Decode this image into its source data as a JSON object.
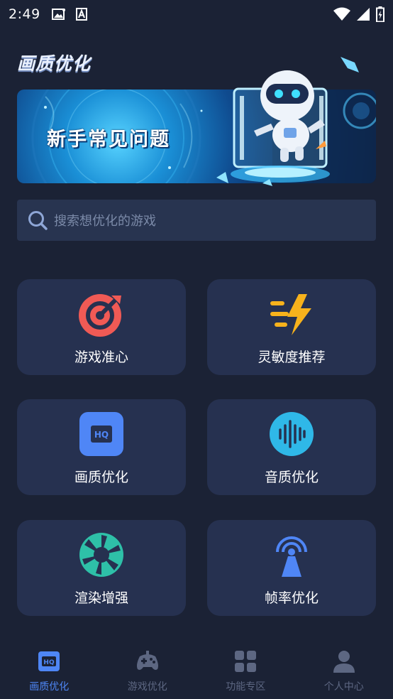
{
  "status_bar": {
    "time": "2:49",
    "left_icons": [
      "image-icon",
      "a-icon"
    ],
    "right_icons": [
      "wifi-icon",
      "signal-icon",
      "battery-icon"
    ]
  },
  "page": {
    "title": "画质优化"
  },
  "banner": {
    "text": "新手常见问题"
  },
  "search": {
    "placeholder": "搜索想优化的游戏"
  },
  "features": [
    {
      "label": "游戏准心",
      "icon": "crosshair-target-icon",
      "color": "#f05a55"
    },
    {
      "label": "灵敏度推荐",
      "icon": "lightning-icon",
      "color": "#f7b21c"
    },
    {
      "label": "画质优化",
      "icon": "hq-icon",
      "color": "#4f86f6"
    },
    {
      "label": "音质优化",
      "icon": "sound-wave-icon",
      "color": "#2fb8e8"
    },
    {
      "label": "渲染增强",
      "icon": "aperture-icon",
      "color": "#2ec0a8"
    },
    {
      "label": "帧率优化",
      "icon": "broadcast-tower-icon",
      "color": "#4f86f6"
    }
  ],
  "bottom_nav": {
    "items": [
      {
        "label": "画质优化",
        "icon": "hq-icon",
        "active": true
      },
      {
        "label": "游戏优化",
        "icon": "gamepad-icon",
        "active": false
      },
      {
        "label": "功能专区",
        "icon": "grid-icon",
        "active": false
      },
      {
        "label": "个人中心",
        "icon": "user-icon",
        "active": false
      }
    ]
  },
  "colors": {
    "background": "#1b2235",
    "card": "#263150",
    "accent": "#4e86f5",
    "inactive": "#5d6782"
  }
}
